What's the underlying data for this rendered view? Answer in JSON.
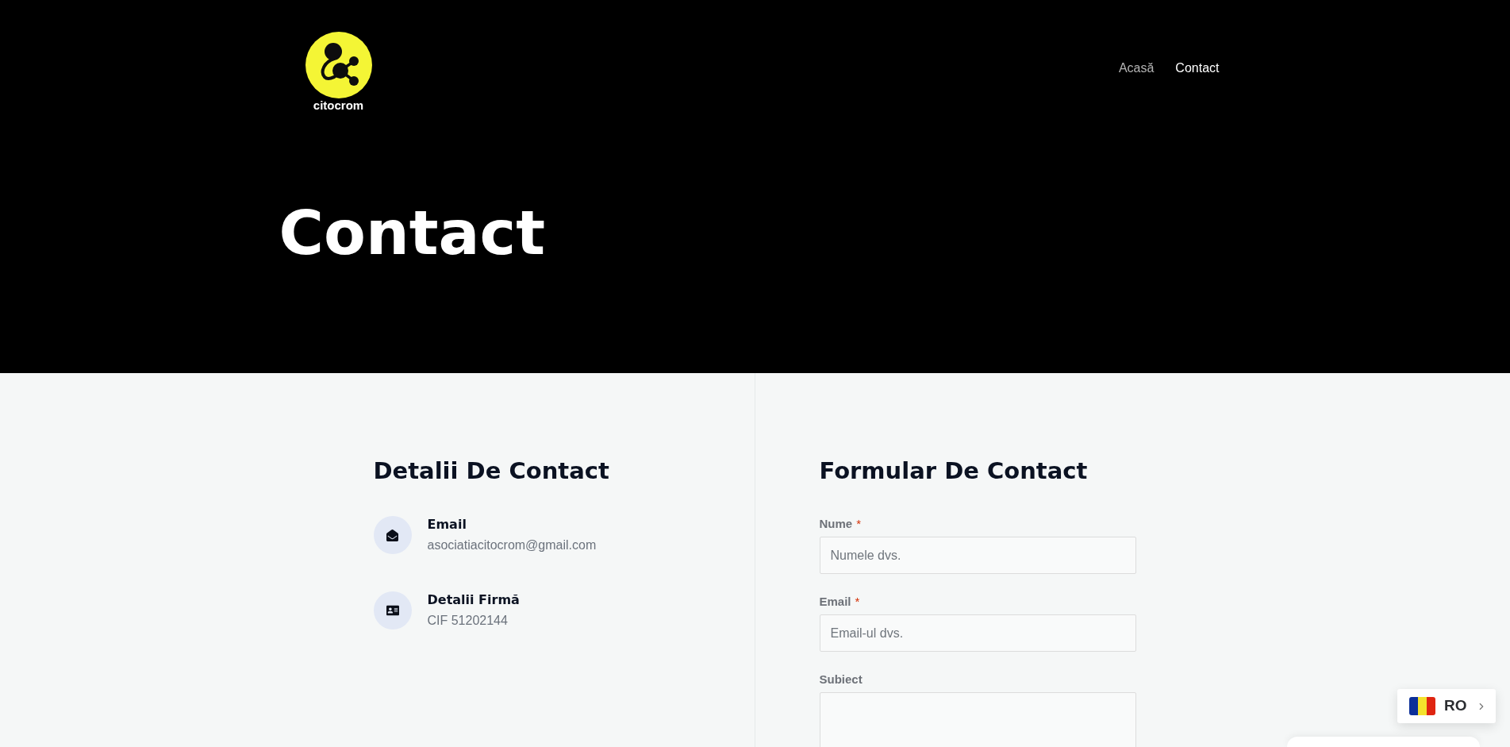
{
  "header": {
    "logo_text": "citocrom",
    "nav": [
      {
        "label": "Acasă",
        "selected": false
      },
      {
        "label": "Contact",
        "selected": true
      }
    ]
  },
  "hero": {
    "title": "Contact"
  },
  "contact_details": {
    "title": "Detalii De Contact",
    "items": [
      {
        "kind": "email",
        "label": "Email",
        "value": "asociatiacitocrom@gmail.com"
      },
      {
        "kind": "company",
        "label": "Detalii Firmă",
        "value": "CIF 51202144"
      }
    ]
  },
  "contact_form": {
    "title": "Formular De Contact",
    "fields": [
      {
        "kind": "input",
        "label": "Nume",
        "required_mark": "*",
        "placeholder": "Numele dvs."
      },
      {
        "kind": "input",
        "label": "Email",
        "required_mark": "*",
        "placeholder": "Email-ul dvs."
      },
      {
        "kind": "textarea",
        "label": "Subiect"
      }
    ]
  },
  "language_switcher": {
    "code": "RO"
  }
}
